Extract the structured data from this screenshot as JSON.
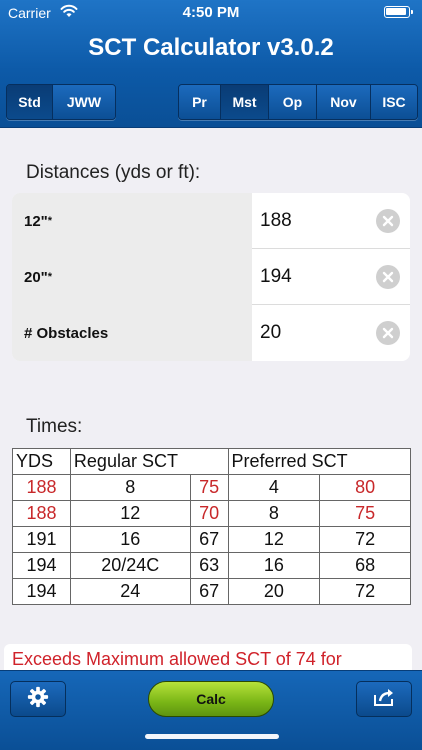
{
  "status_bar": {
    "carrier": "Carrier",
    "time": "4:50 PM"
  },
  "header": {
    "title": "SCT Calculator v3.0.2",
    "left_segment": [
      {
        "label": "Std",
        "selected": true
      },
      {
        "label": "JWW",
        "selected": false
      }
    ],
    "right_segment": [
      {
        "label": "Pr",
        "selected": false
      },
      {
        "label": "Mst",
        "selected": true
      },
      {
        "label": "Op",
        "selected": false
      },
      {
        "label": "Nov",
        "selected": false
      },
      {
        "label": "ISC",
        "selected": false
      }
    ]
  },
  "distances": {
    "heading": "Distances (yds or ft):",
    "rows": [
      {
        "label": "12\"",
        "mark": "*",
        "value": "188"
      },
      {
        "label": "20\"",
        "mark": "*",
        "value": "194"
      },
      {
        "label": "# Obstacles",
        "mark": "",
        "value": "20"
      }
    ]
  },
  "times": {
    "heading": "Times:",
    "headers": {
      "yds": "YDS",
      "regular": "Regular SCT",
      "preferred": "Preferred SCT"
    },
    "rows": [
      {
        "yds": "188",
        "reg_a": "8",
        "reg_b": "75",
        "pref_a": "4",
        "pref_b": "80",
        "highlight": true
      },
      {
        "yds": "188",
        "reg_a": "12",
        "reg_b": "70",
        "pref_a": "8",
        "pref_b": "75",
        "highlight": true
      },
      {
        "yds": "191",
        "reg_a": "16",
        "reg_b": "67",
        "pref_a": "12",
        "pref_b": "72",
        "highlight": false
      },
      {
        "yds": "194",
        "reg_a": "20/24C",
        "reg_b": "63",
        "pref_a": "16",
        "pref_b": "68",
        "highlight": false
      },
      {
        "yds": "194",
        "reg_a": "24",
        "reg_b": "67",
        "pref_a": "20",
        "pref_b": "72",
        "highlight": false
      }
    ]
  },
  "warning": "Exceeds Maximum allowed SCT of 74 for",
  "toolbar": {
    "calc_label": "Calc"
  },
  "colors": {
    "header_blue": "#0d5aa8",
    "highlight_red": "#c8282a",
    "calc_green": "#79b516"
  }
}
